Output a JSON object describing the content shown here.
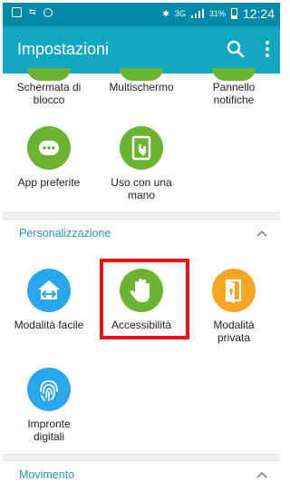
{
  "status_bar": {
    "network": "3G",
    "battery": "31%",
    "time": "12:24"
  },
  "app_bar": {
    "title": "Impostazioni"
  },
  "icons": {
    "search": "search-icon",
    "overflow": "more-vert-icon"
  },
  "top_row": [
    {
      "label_line1": "Schermata di",
      "label_line2": "blocco"
    },
    {
      "label_line1": "Multischermo",
      "label_line2": ""
    },
    {
      "label_line1": "Pannello",
      "label_line2": "notifiche"
    }
  ],
  "row2": [
    {
      "label_line1": "App preferite",
      "label_line2": "",
      "icon": "more-horiz-icon"
    },
    {
      "label_line1": "Uso con una",
      "label_line2": "mano",
      "icon": "one-hand-icon"
    }
  ],
  "personalizzazione": {
    "title": "Personalizzazione",
    "items": [
      {
        "label_line1": "Modalità facile",
        "label_line2": "",
        "icon": "home-arrows-icon"
      },
      {
        "label_line1": "Accessibilità",
        "label_line2": "",
        "icon": "hand-icon"
      },
      {
        "label_line1": "Modalità",
        "label_line2": "privata",
        "icon": "lock-door-icon"
      },
      {
        "label_line1": "Impronte",
        "label_line2": "digitali",
        "icon": "fingerprint-icon"
      }
    ]
  },
  "movimento": {
    "title": "Movimento"
  },
  "colors": {
    "status_bar": "#0089a8",
    "app_bar": "#12a7c1",
    "accent": "#2a97b4",
    "highlight": "#ee1111"
  }
}
